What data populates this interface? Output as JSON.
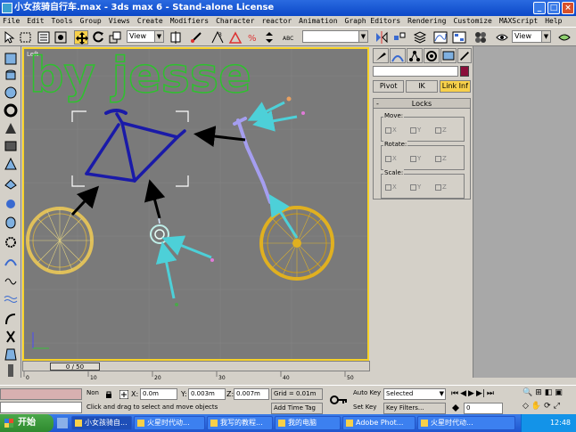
{
  "window": {
    "title": "小女孩骑自行车.max - 3ds max 6 - Stand-alone License"
  },
  "menu": [
    "File",
    "Edit",
    "Tools",
    "Group",
    "Views",
    "Create",
    "Modifiers",
    "Character",
    "reactor",
    "Animation",
    "Graph Editors",
    "Rendering",
    "Customize",
    "MAXScript",
    "Help"
  ],
  "toolbar": {
    "ref_coord": "View",
    "selection_set": "",
    "right_view": "View"
  },
  "viewport": {
    "label": "Left",
    "watermark": "by jesse",
    "ruler_ticks": [
      "0",
      "10",
      "20",
      "30",
      "40",
      "50"
    ]
  },
  "command_panel": {
    "subtabs": [
      "Pivot",
      "IK",
      "Link Inf"
    ],
    "locks": {
      "title": "Locks",
      "groups": [
        {
          "label": "Move:",
          "axes": [
            "X",
            "Y",
            "Z"
          ]
        },
        {
          "label": "Rotate:",
          "axes": [
            "X",
            "Y",
            "Z"
          ]
        },
        {
          "label": "Scale:",
          "axes": [
            "X",
            "Y",
            "Z"
          ]
        }
      ]
    }
  },
  "timeslider": {
    "label": "0 / 50"
  },
  "status": {
    "selection": "Non",
    "x": "0.0m",
    "y": "0.003m",
    "z": "0.007m",
    "grid": "Grid = 0.01m",
    "prompt": "Click and drag to select and move objects",
    "add_time_tag": "Add Time Tag",
    "auto_key": "Auto Key",
    "set_key": "Set Key",
    "key_mode": "Selected",
    "key_filters": "Key Filters...",
    "frame": "0"
  },
  "taskbar": {
    "start": "开始",
    "tasks": [
      "小女孩骑自...",
      "火星时代动...",
      "我写的教程...",
      "我的电脑",
      "Adobe Phot...",
      "火星时代动..."
    ],
    "clock": "12:48"
  }
}
